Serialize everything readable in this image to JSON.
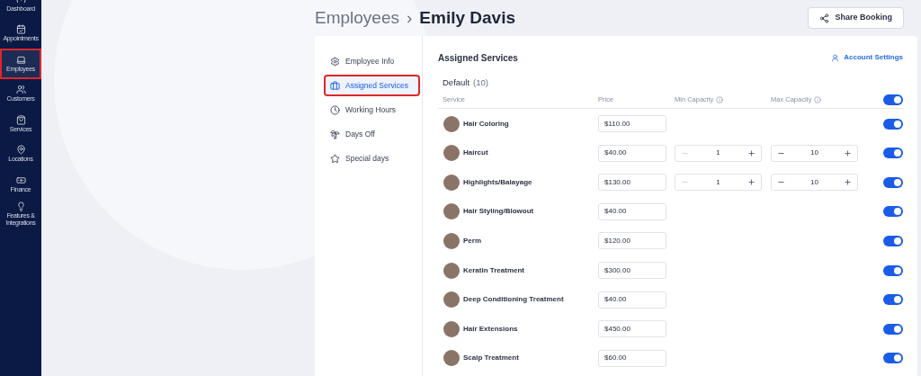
{
  "sidebar": {
    "items": [
      {
        "label": "Dashboard",
        "selected": false
      },
      {
        "label": "Appointments",
        "selected": false
      },
      {
        "label": "Employees",
        "selected": true
      },
      {
        "label": "Customers",
        "selected": false
      },
      {
        "label": "Services",
        "selected": false
      },
      {
        "label": "Locations",
        "selected": false
      },
      {
        "label": "Finance",
        "selected": false
      },
      {
        "label": "Features & Integrations",
        "selected": false
      }
    ]
  },
  "breadcrumb": {
    "parent": "Employees",
    "separator": "›",
    "current": "Emily Davis"
  },
  "share_button": "Share Booking",
  "tabs": [
    {
      "label": "Employee Info",
      "selected": false
    },
    {
      "label": "Assigned Services",
      "selected": true
    },
    {
      "label": "Working Hours",
      "selected": false
    },
    {
      "label": "Days Off",
      "selected": false
    },
    {
      "label": "Special days",
      "selected": false
    }
  ],
  "section_title": "Assigned Services",
  "account_settings": "Account Settings",
  "group": {
    "name": "Default",
    "count": "(10)"
  },
  "columns": {
    "service": "Service",
    "price": "Price",
    "min_capacity": "Min Capacity",
    "max_capacity": "Max Capacity"
  },
  "all_on": true,
  "rows": [
    {
      "name": "Hair Coloring",
      "price": "$110.00",
      "on": true
    },
    {
      "name": "Haircut",
      "price": "$40.00",
      "min": "1",
      "max": "10",
      "on": true
    },
    {
      "name": "Highlights/Balayage",
      "price": "$130.00",
      "min": "1",
      "max": "10",
      "on": true
    },
    {
      "name": "Hair Styling/Blowout",
      "price": "$40.00",
      "on": true
    },
    {
      "name": "Perm",
      "price": "$120.00",
      "on": true
    },
    {
      "name": "Keratin Treatment",
      "price": "$300.00",
      "on": true
    },
    {
      "name": "Deep Conditioning Treatment",
      "price": "$40.00",
      "on": true
    },
    {
      "name": "Hair Extensions",
      "price": "$450.00",
      "on": true
    },
    {
      "name": "Scalp Treatment",
      "price": "$60.00",
      "on": true
    }
  ]
}
